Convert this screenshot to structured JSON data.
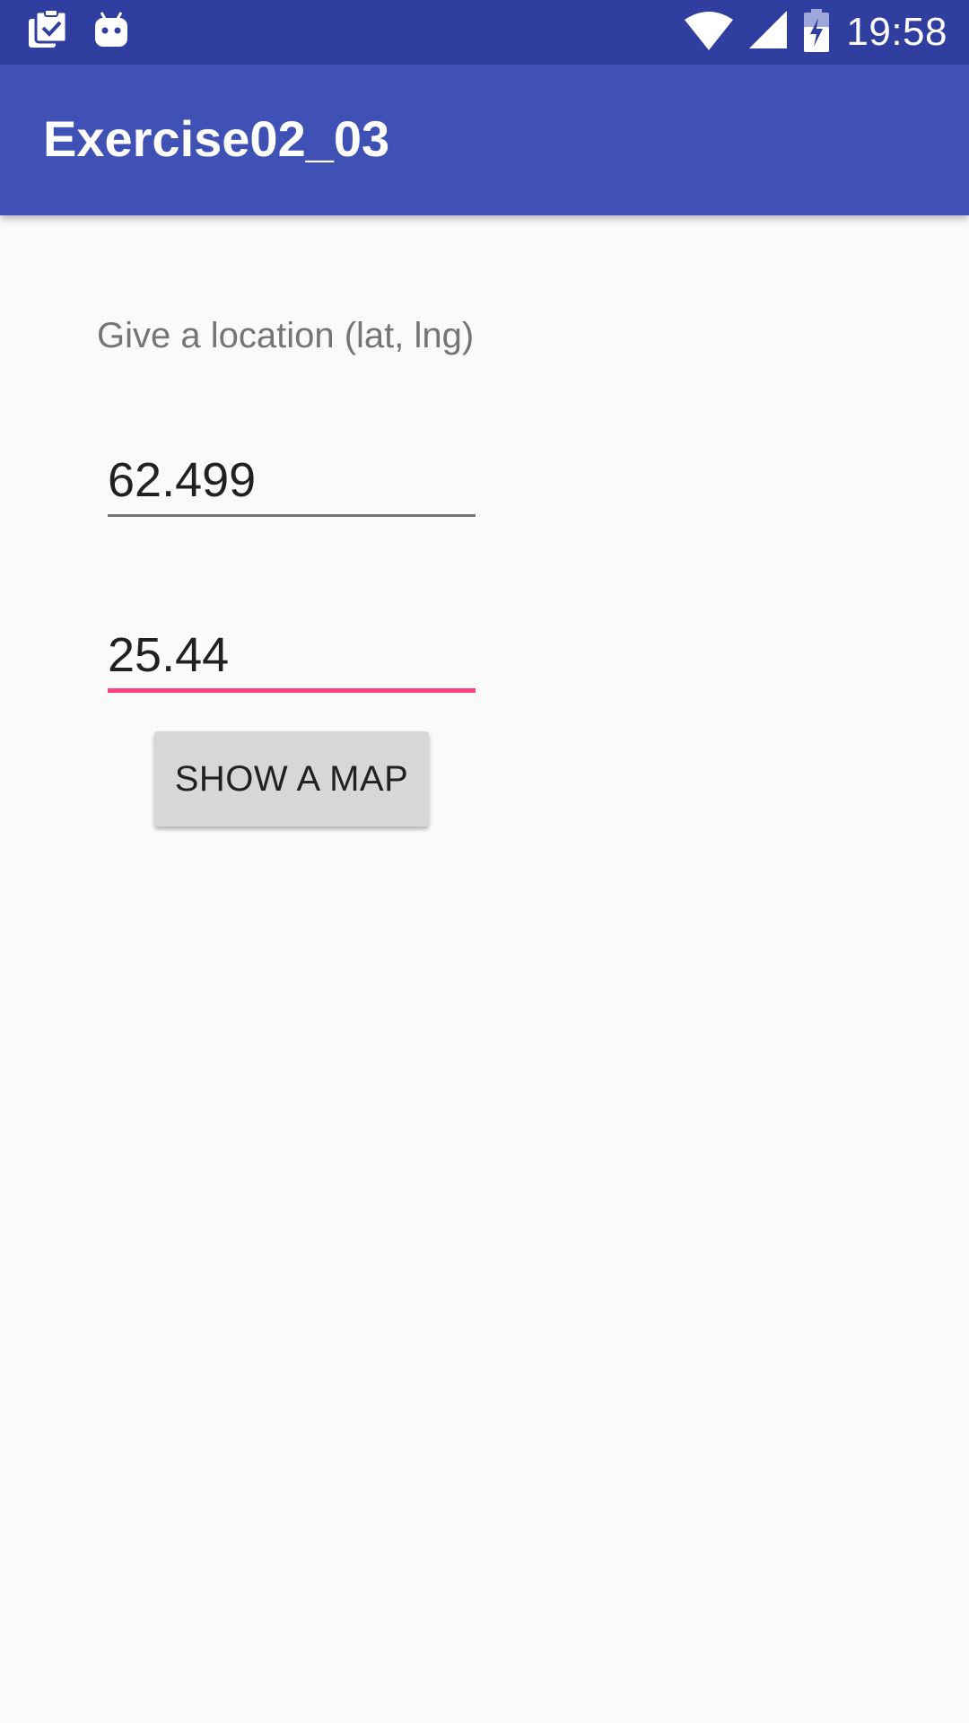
{
  "status_bar": {
    "time": "19:58",
    "left_icons": [
      "clipboard-check-icon",
      "android-icon"
    ],
    "right_icons": [
      "wifi-icon",
      "cell-signal-icon",
      "battery-charging-icon"
    ],
    "background": "#303f9f"
  },
  "app_bar": {
    "title": "Exercise02_03",
    "background": "#3f51b5"
  },
  "form": {
    "prompt": "Give a location (lat, lng)",
    "latitude_value": "62.499",
    "longitude_value": "25.44",
    "focused_underline_color": "#ff4081",
    "button_label": "SHOW A MAP"
  }
}
